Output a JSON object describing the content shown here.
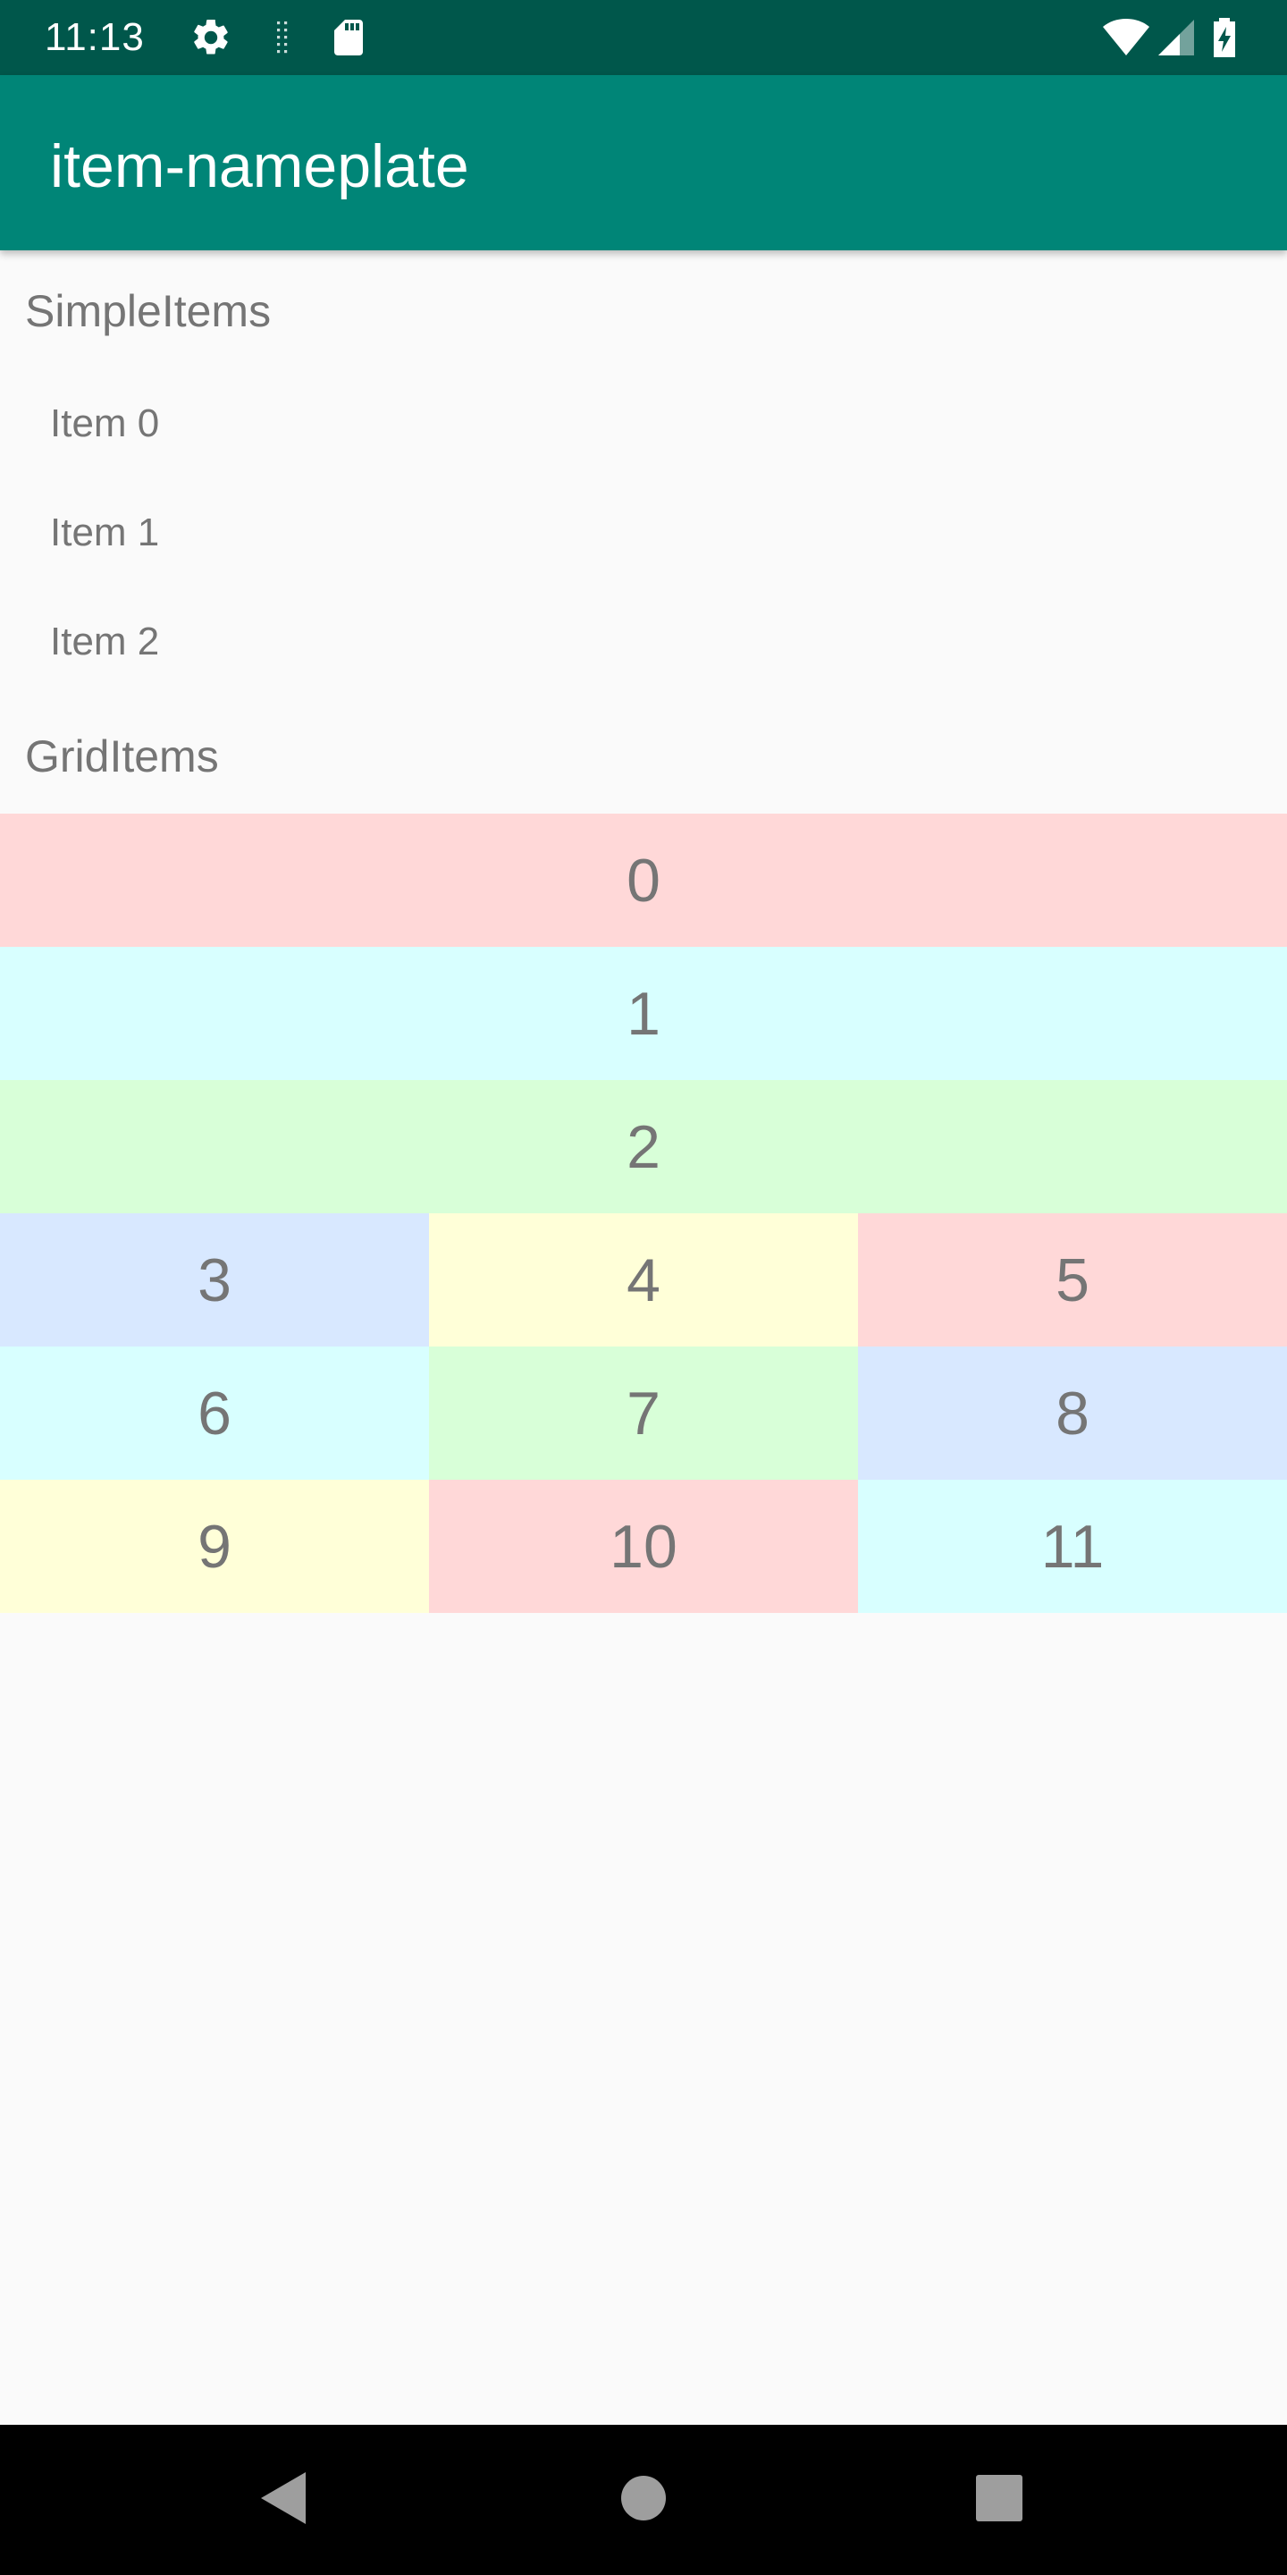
{
  "status_bar": {
    "time": "11:13",
    "left_icons": [
      "gear-icon",
      "network-activity-icon",
      "sd-card-icon"
    ],
    "right_icons": [
      "wifi-icon",
      "cell-signal-icon",
      "battery-charging-icon"
    ]
  },
  "app_bar": {
    "title": "item-nameplate",
    "color": "#008577"
  },
  "simple_section": {
    "header": "SimpleItems",
    "items": [
      "Item 0",
      "Item 1",
      "Item 2"
    ]
  },
  "grid_section": {
    "header": "GridItems",
    "cells": [
      {
        "label": "0",
        "color": "#ffd8d8"
      },
      {
        "label": "1",
        "color": "#d8ffff"
      },
      {
        "label": "2",
        "color": "#d8ffd8"
      },
      {
        "label": "3",
        "color": "#d8e8ff"
      },
      {
        "label": "4",
        "color": "#ffffd8"
      },
      {
        "label": "5",
        "color": "#ffd8d8"
      },
      {
        "label": "6",
        "color": "#d8ffff"
      },
      {
        "label": "7",
        "color": "#d8ffd8"
      },
      {
        "label": "8",
        "color": "#d8e8ff"
      },
      {
        "label": "9",
        "color": "#ffffd8"
      },
      {
        "label": "10",
        "color": "#ffd8d8"
      },
      {
        "label": "11",
        "color": "#d8ffff"
      }
    ]
  },
  "nav_bar": {
    "buttons": [
      "back-icon",
      "home-icon",
      "recents-icon"
    ]
  }
}
